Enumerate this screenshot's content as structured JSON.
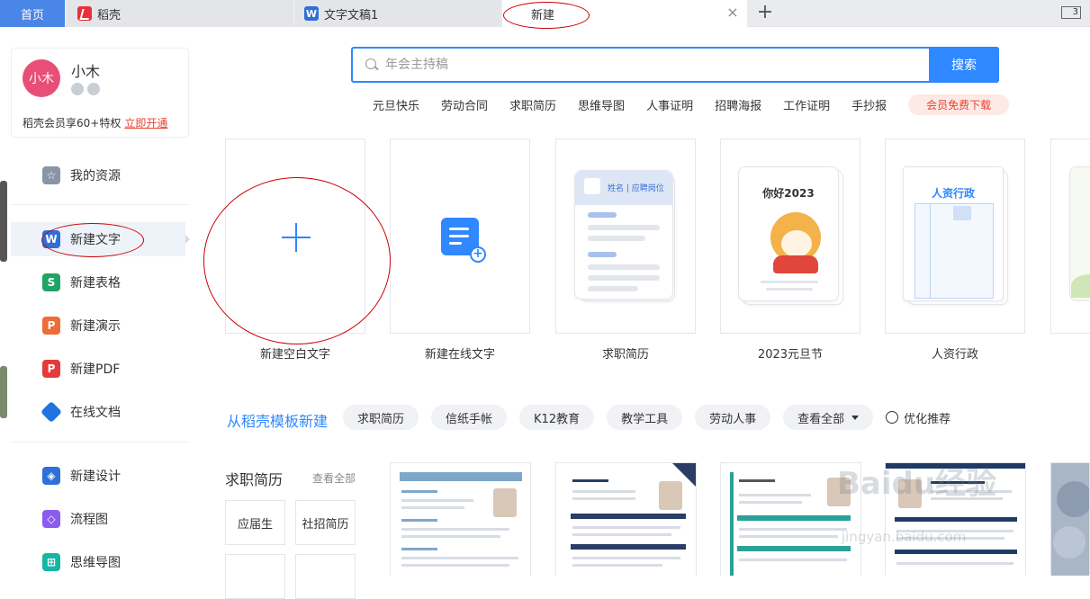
{
  "tabs": {
    "home": "首页",
    "daoke": "稻壳",
    "doc": "文字文稿1",
    "new": "新建",
    "right_count": "3"
  },
  "user": {
    "avatar_text": "小木",
    "name": "小木",
    "vip_text": "稻壳会员享60+特权",
    "vip_link": "立即开通"
  },
  "sidebar": {
    "items": [
      {
        "label": "我的资源",
        "icon": "star-icon"
      },
      {
        "label": "新建文字",
        "icon": "w-doc-icon"
      },
      {
        "label": "新建表格",
        "icon": "s-sheet-icon"
      },
      {
        "label": "新建演示",
        "icon": "p-slides-icon"
      },
      {
        "label": "新建PDF",
        "icon": "pdf-icon"
      },
      {
        "label": "在线文档",
        "icon": "online-doc-icon"
      },
      {
        "label": "新建设计",
        "icon": "design-icon"
      },
      {
        "label": "流程图",
        "icon": "flowchart-icon"
      },
      {
        "label": "思维导图",
        "icon": "mindmap-icon"
      }
    ]
  },
  "search": {
    "placeholder": "年会主持稿",
    "button": "搜索"
  },
  "hot_tags": [
    "元旦快乐",
    "劳动合同",
    "求职简历",
    "思维导图",
    "人事证明",
    "招聘海报",
    "工作证明",
    "手抄报"
  ],
  "hot_vip": "会员免费下载",
  "new_cards": {
    "blank": "新建空白文字",
    "online": "新建在线文字",
    "resume": "求职简历",
    "resume_header": "姓名 | 应聘岗位",
    "newyear": "2023元旦节",
    "newyear_title": "你好2023",
    "hr": "人资行政",
    "hr_title": "人资行政"
  },
  "templates": {
    "title": "从稻壳模板新建",
    "chips": [
      "求职简历",
      "信纸手帐",
      "K12教育",
      "教学工具",
      "劳动人事"
    ],
    "view_all": "查看全部",
    "optimize": "优化推荐",
    "category_title": "求职简历",
    "category_all": "查看全部",
    "category_boxes": [
      "应届生",
      "社招简历"
    ]
  },
  "watermark": {
    "main": "Baidu经验",
    "sub": "jingyan.baidu.com"
  },
  "colors": {
    "accent": "#2f88ff",
    "home_tab": "#4a86e8",
    "vip_red": "#e8432e",
    "annotation": "#cc0000"
  }
}
